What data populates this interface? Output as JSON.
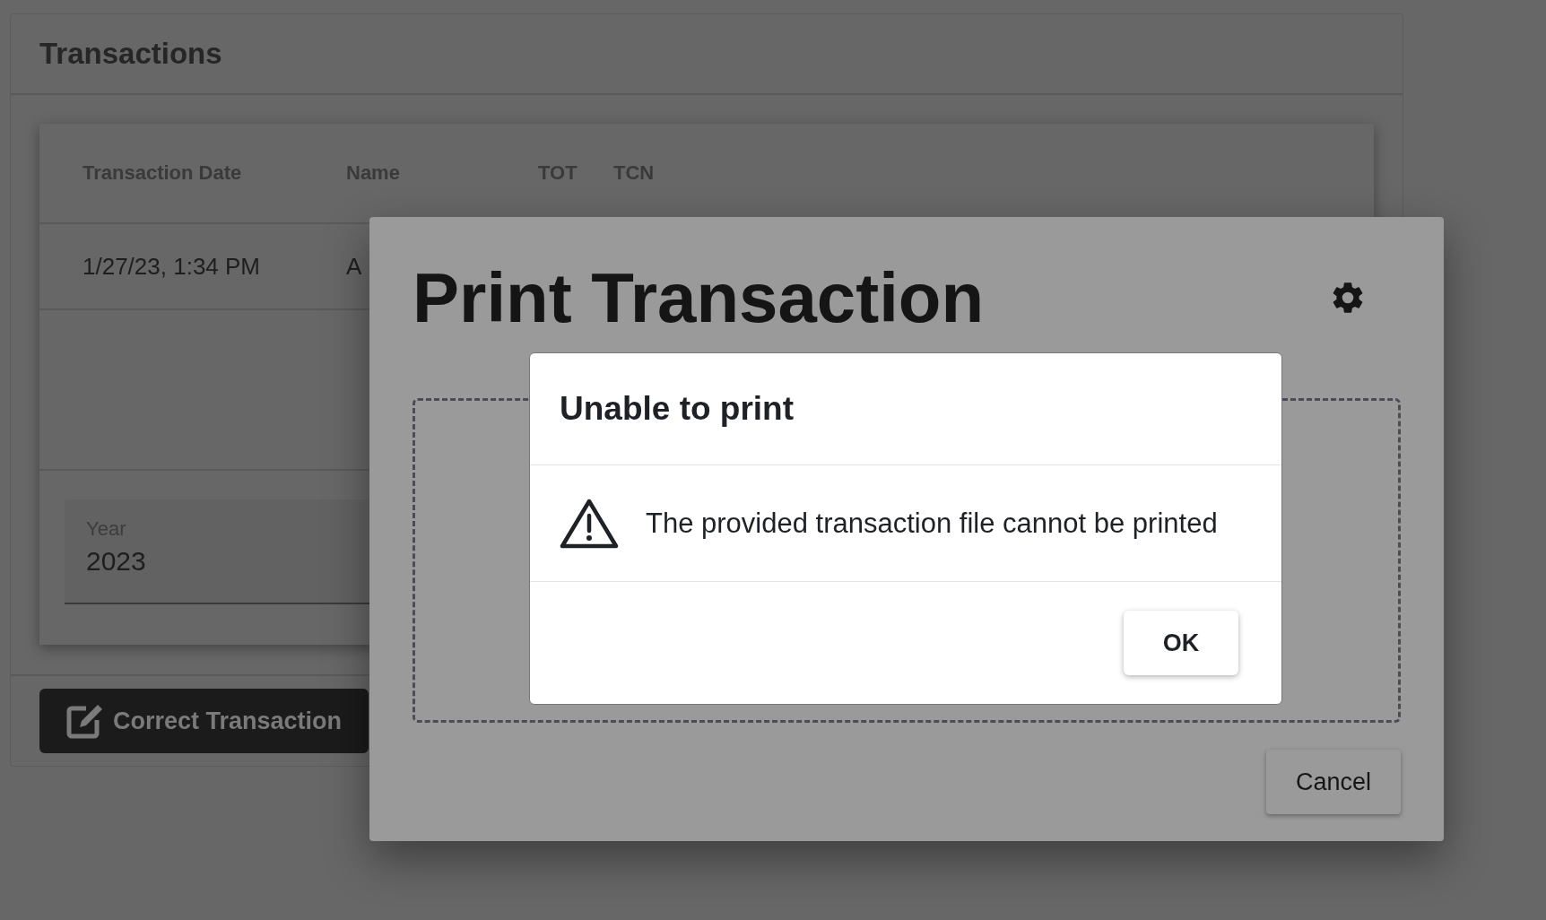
{
  "page": {
    "title": "Transactions"
  },
  "table": {
    "columns": [
      "Transaction Date",
      "Name",
      "TOT",
      "TCN"
    ],
    "rows": [
      [
        "1/27/23, 1:34 PM",
        "A"
      ]
    ]
  },
  "year_field": {
    "label": "Year",
    "value": "2023"
  },
  "correct_button": {
    "label": "Correct Transaction"
  },
  "print_dialog": {
    "title": "Print Transaction",
    "cancel": "Cancel"
  },
  "alert": {
    "title": "Unable to print",
    "message": "The provided transaction file cannot be printed",
    "ok": "OK"
  }
}
